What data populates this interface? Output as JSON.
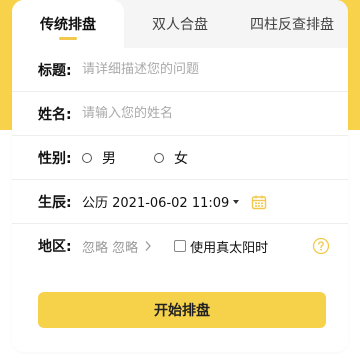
{
  "tabs": [
    {
      "label": "传统排盘",
      "active": true
    },
    {
      "label": "双人合盘",
      "active": false
    },
    {
      "label": "四柱反查排盘",
      "active": false
    }
  ],
  "form": {
    "title": {
      "label": "标题:",
      "placeholder": "请详细描述您的问题",
      "value": ""
    },
    "name": {
      "label": "姓名:",
      "placeholder": "请输入您的姓名",
      "value": ""
    },
    "gender": {
      "label": "性别:",
      "options": [
        "男",
        "女"
      ]
    },
    "birth": {
      "label": "生辰:",
      "value": "公历 2021-06-02 11:09"
    },
    "region": {
      "label": "地区:",
      "value": "忽略 忽略",
      "true_solar_label": "使用真太阳时"
    }
  },
  "submit_label": "开始排盘",
  "colors": {
    "accent": "#F6D24A",
    "header_band": "#F8D24A",
    "calendar_icon": "#F2C94C",
    "help_icon": "#F2C94C"
  },
  "icons": [
    "calendar-icon",
    "chevron-right-icon",
    "help-circle-icon",
    "radio-icon",
    "checkbox-icon"
  ]
}
